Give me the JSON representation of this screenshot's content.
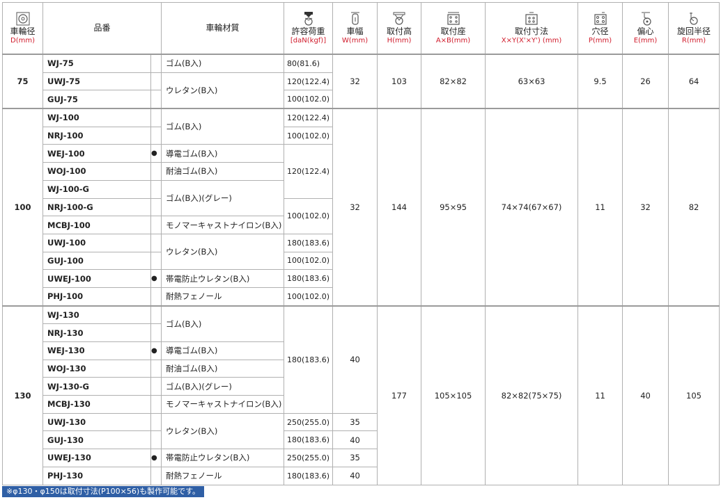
{
  "headers": {
    "diameter": {
      "label": "車輪径",
      "unit": "D(mm)"
    },
    "part_no": {
      "label": "品番"
    },
    "material": {
      "label": "車輪材質"
    },
    "load": {
      "label": "許容荷重",
      "unit": "[daN(kgf)]"
    },
    "width": {
      "label": "車幅",
      "unit": "W(mm)"
    },
    "height": {
      "label": "取付高",
      "unit": "H(mm)"
    },
    "base": {
      "label": "取付座",
      "unit": "A×B(mm)"
    },
    "mount": {
      "label": "取付寸法",
      "unit": "X×Y(X'×Y') (mm)"
    },
    "hole": {
      "label": "穴径",
      "unit": "P(mm)"
    },
    "offset": {
      "label": "偏心",
      "unit": "E(mm)"
    },
    "radius": {
      "label": "旋回半径",
      "unit": "R(mm)"
    }
  },
  "marker": "●",
  "groups": [
    {
      "diameter": "75",
      "width": "32",
      "height": "103",
      "base": "82×82",
      "mount": "63×63",
      "hole": "9.5",
      "offset": "26",
      "radius": "64",
      "rows": [
        {
          "part": "WJ-75",
          "dot": false,
          "material": "ゴム(B入)",
          "load": "80(81.6)"
        },
        {
          "part": "UWJ-75",
          "dot": false,
          "material": "ウレタン(B入)",
          "load": "120(122.4)"
        },
        {
          "part": "GUJ-75",
          "dot": false,
          "material": "",
          "load": "100(102.0)"
        }
      ]
    },
    {
      "diameter": "100",
      "width": "32",
      "height": "144",
      "base": "95×95",
      "mount": "74×74(67×67)",
      "hole": "11",
      "offset": "32",
      "radius": "82",
      "rows": [
        {
          "part": "WJ-100",
          "dot": false,
          "material": "ゴム(B入)",
          "load": "120(122.4)"
        },
        {
          "part": "NRJ-100",
          "dot": false,
          "material": "",
          "load": "100(102.0)"
        },
        {
          "part": "WEJ-100",
          "dot": true,
          "material": "導電ゴム(B入)",
          "load": "120(122.4)"
        },
        {
          "part": "WOJ-100",
          "dot": false,
          "material": "耐油ゴム(B入)",
          "load": ""
        },
        {
          "part": "WJ-100-G",
          "dot": false,
          "material": "ゴム(B入)(グレー)",
          "load": ""
        },
        {
          "part": "NRJ-100-G",
          "dot": false,
          "material": "",
          "load": "100(102.0)"
        },
        {
          "part": "MCBJ-100",
          "dot": false,
          "material": "モノマーキャストナイロン(B入)",
          "load": ""
        },
        {
          "part": "UWJ-100",
          "dot": false,
          "material": "ウレタン(B入)",
          "load": "180(183.6)"
        },
        {
          "part": "GUJ-100",
          "dot": false,
          "material": "",
          "load": "100(102.0)"
        },
        {
          "part": "UWEJ-100",
          "dot": true,
          "material": "帯電防止ウレタン(B入)",
          "load": "180(183.6)"
        },
        {
          "part": "PHJ-100",
          "dot": false,
          "material": "耐熱フェノール",
          "load": "100(102.0)"
        }
      ]
    },
    {
      "diameter": "130",
      "width": "",
      "height": "177",
      "base": "105×105",
      "mount": "82×82(75×75)",
      "hole": "11",
      "offset": "40",
      "radius": "105",
      "rows": [
        {
          "part": "WJ-130",
          "dot": false,
          "material": "ゴム(B入)",
          "load": "180(183.6)",
          "width": "40"
        },
        {
          "part": "NRJ-130",
          "dot": false,
          "material": "",
          "load": "",
          "width": ""
        },
        {
          "part": "WEJ-130",
          "dot": true,
          "material": "導電ゴム(B入)",
          "load": "",
          "width": ""
        },
        {
          "part": "WOJ-130",
          "dot": false,
          "material": "耐油ゴム(B入)",
          "load": "",
          "width": ""
        },
        {
          "part": "WJ-130-G",
          "dot": false,
          "material": "ゴム(B入)(グレー)",
          "load": "",
          "width": ""
        },
        {
          "part": "MCBJ-130",
          "dot": false,
          "material": "モノマーキャストナイロン(B入)",
          "load": "",
          "width": ""
        },
        {
          "part": "UWJ-130",
          "dot": false,
          "material": "ウレタン(B入)",
          "load": "250(255.0)",
          "width": "35"
        },
        {
          "part": "GUJ-130",
          "dot": false,
          "material": "",
          "load": "180(183.6)",
          "width": "40"
        },
        {
          "part": "UWEJ-130",
          "dot": true,
          "material": "帯電防止ウレタン(B入)",
          "load": "250(255.0)",
          "width": "35"
        },
        {
          "part": "PHJ-130",
          "dot": false,
          "material": "耐熱フェノール",
          "load": "180(183.6)",
          "width": "40"
        }
      ]
    }
  ],
  "note": "※φ130・φ150は取付寸法(P100×56)も製作可能です。"
}
